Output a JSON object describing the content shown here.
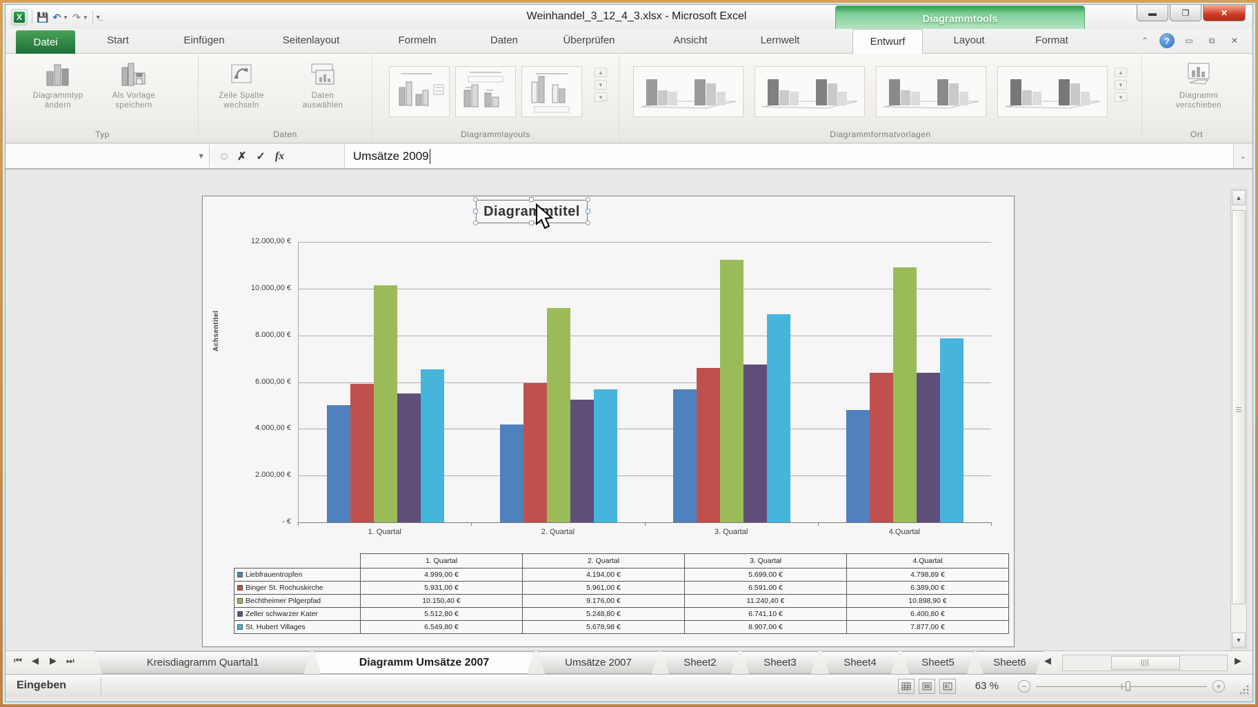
{
  "window": {
    "title": "Weinhandel_3_12_4_3.xlsx  -  Microsoft Excel",
    "contextual_tool": "Diagrammtools",
    "buttons": {
      "minimize": "0",
      "maximize": "1",
      "close": "X"
    }
  },
  "tabs": {
    "file": "Datei",
    "items": [
      "Start",
      "Einfügen",
      "Seitenlayout",
      "Formeln",
      "Daten",
      "Überprüfen",
      "Ansicht",
      "Lernwelt"
    ],
    "contextual": [
      "Entwurf",
      "Layout",
      "Format"
    ],
    "active": "Entwurf"
  },
  "ribbon": {
    "groups": {
      "typ": {
        "label": "Typ",
        "buttons": [
          "Diagrammtyp ändern",
          "Als Vorlage speichern"
        ]
      },
      "daten": {
        "label": "Daten",
        "buttons": [
          "Zeile Spalte wechseln",
          "Daten auswählen"
        ]
      },
      "layouts": {
        "label": "Diagrammlayouts"
      },
      "styles": {
        "label": "Diagrammformatvorlagen"
      },
      "ort": {
        "label": "Ort",
        "buttons": [
          "Diagramm verschieben"
        ]
      }
    }
  },
  "formula_bar": {
    "value": "Umsätze 2009",
    "fx_label": "fx",
    "cancel_glyph": "✗",
    "enter_glyph": "✓"
  },
  "chart_data": {
    "type": "bar",
    "title": "Diagrammtitel",
    "y_axis_title": "Achsentitel",
    "categories": [
      "1. Quartal",
      "2. Quartal",
      "3. Quartal",
      "4.Quartal"
    ],
    "series": [
      {
        "name": "Liebfrauentropfen",
        "color": "#4F81BD",
        "values": [
          4999.0,
          4194.0,
          5699.0,
          4798.89
        ],
        "labels": [
          "4.999,00 €",
          "4.194,00 €",
          "5.699,00 €",
          "4.798,89 €"
        ]
      },
      {
        "name": "Binger St. Rochuskirche",
        "color": "#C0504D",
        "values": [
          5931.0,
          5961.0,
          6591.0,
          6389.0
        ],
        "labels": [
          "5.931,00 €",
          "5.961,00 €",
          "6.591,00 €",
          "6.389,00 €"
        ]
      },
      {
        "name": "Bechtheimer Pilgerpfad",
        "color": "#9BBB59",
        "values": [
          10150.4,
          9176.0,
          11240.4,
          10898.9
        ],
        "labels": [
          "10.150,40 €",
          "9.176,00 €",
          "11.240,40 €",
          "10.898,90 €"
        ]
      },
      {
        "name": "Zeller schwarzer Kater",
        "color": "#5F4E79",
        "values": [
          5512.8,
          5248.8,
          6741.1,
          6400.8
        ],
        "labels": [
          "5.512,80 €",
          "5.248,80 €",
          "6.741,10 €",
          "6.400,80 €"
        ]
      },
      {
        "name": "St. Hubert Villages",
        "color": "#45B5DC",
        "values": [
          6549.8,
          5678.98,
          8907.0,
          7877.0
        ],
        "labels": [
          "6.549,80 €",
          "5.678,98 €",
          "8.907,00 €",
          "7.877,00 €"
        ]
      }
    ],
    "ylim": [
      0,
      12000
    ],
    "ytick_labels": [
      "12.000,00 €",
      "10.000,00 €",
      "8.000,00 €",
      "6.000,00 €",
      "4.000,00 €",
      "2.000,00 €",
      "-   €"
    ],
    "grid": true,
    "legend_position": "data-table",
    "data_table_shown": true
  },
  "sheets": {
    "items": [
      {
        "label": "Kreisdiagramm Quartal1",
        "active": false
      },
      {
        "label": "Diagramm Umsätze 2007",
        "active": true
      },
      {
        "label": "Umsätze 2007",
        "active": false
      },
      {
        "label": "Sheet2",
        "active": false
      },
      {
        "label": "Sheet3",
        "active": false
      },
      {
        "label": "Sheet4",
        "active": false
      },
      {
        "label": "Sheet5",
        "active": false
      },
      {
        "label": "Sheet6",
        "active": false
      }
    ]
  },
  "status_bar": {
    "mode": "Eingeben",
    "zoom": "63 %"
  }
}
